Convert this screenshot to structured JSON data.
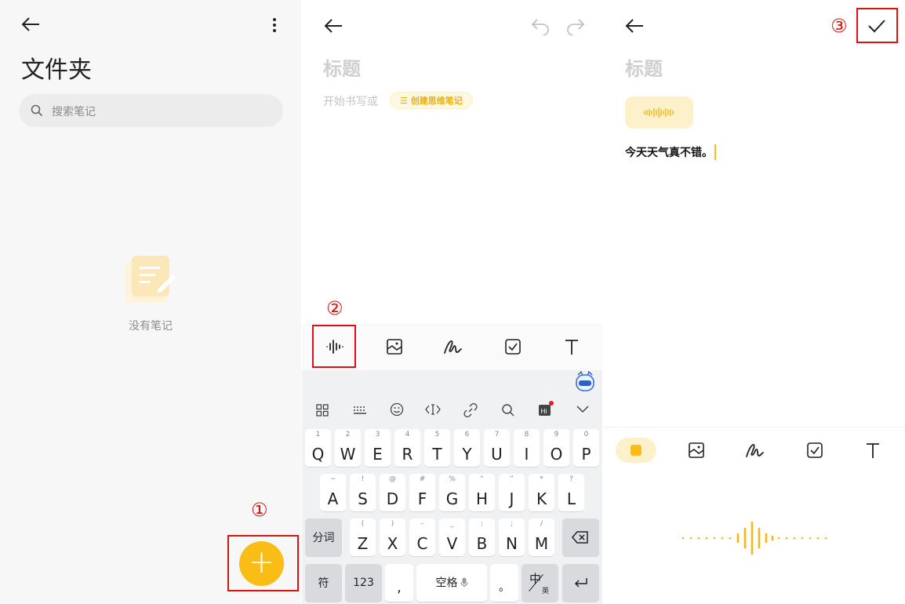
{
  "folder_screen": {
    "title": "文件夹",
    "search_placeholder": "搜索笔记",
    "empty_text": "没有笔记",
    "fab_label": "+",
    "step_number": "①"
  },
  "editor_screen": {
    "title_placeholder": "标题",
    "start_text": "开始书写或",
    "mind_map_chip": "☰ 创建思维笔记",
    "step_number": "②",
    "keyboard": {
      "row1": [
        {
          "hint": "1",
          "letter": "Q"
        },
        {
          "hint": "2",
          "letter": "W"
        },
        {
          "hint": "3",
          "letter": "E"
        },
        {
          "hint": "4",
          "letter": "R"
        },
        {
          "hint": "5",
          "letter": "T"
        },
        {
          "hint": "6",
          "letter": "Y"
        },
        {
          "hint": "7",
          "letter": "U"
        },
        {
          "hint": "8",
          "letter": "I"
        },
        {
          "hint": "9",
          "letter": "O"
        },
        {
          "hint": "0",
          "letter": "P"
        }
      ],
      "row2": [
        {
          "hint": "~",
          "letter": "A"
        },
        {
          "hint": "!",
          "letter": "S"
        },
        {
          "hint": "@",
          "letter": "D"
        },
        {
          "hint": "#",
          "letter": "F"
        },
        {
          "hint": "%",
          "letter": "G"
        },
        {
          "hint": "“",
          "letter": "H"
        },
        {
          "hint": "”",
          "letter": "J"
        },
        {
          "hint": "*",
          "letter": "K"
        },
        {
          "hint": "?",
          "letter": "L"
        }
      ],
      "row3": [
        {
          "hint": "(",
          "letter": "Z"
        },
        {
          "hint": ")",
          "letter": "X"
        },
        {
          "hint": "–",
          "letter": "C"
        },
        {
          "hint": "_",
          "letter": "V"
        },
        {
          "hint": ":",
          "letter": "B"
        },
        {
          "hint": ";",
          "letter": "N"
        },
        {
          "hint": "/",
          "letter": "M"
        }
      ],
      "fenci": "分词",
      "fu": "符",
      "num": "123",
      "comma": ",",
      "space": "空格",
      "period": "。",
      "zh": "中",
      "en": "英"
    }
  },
  "voice_screen": {
    "title_placeholder": "标题",
    "body_text": "今天天气真不错。",
    "step_number": "③"
  },
  "colors": {
    "accent": "#f9bd16",
    "annotation": "#e01010"
  }
}
